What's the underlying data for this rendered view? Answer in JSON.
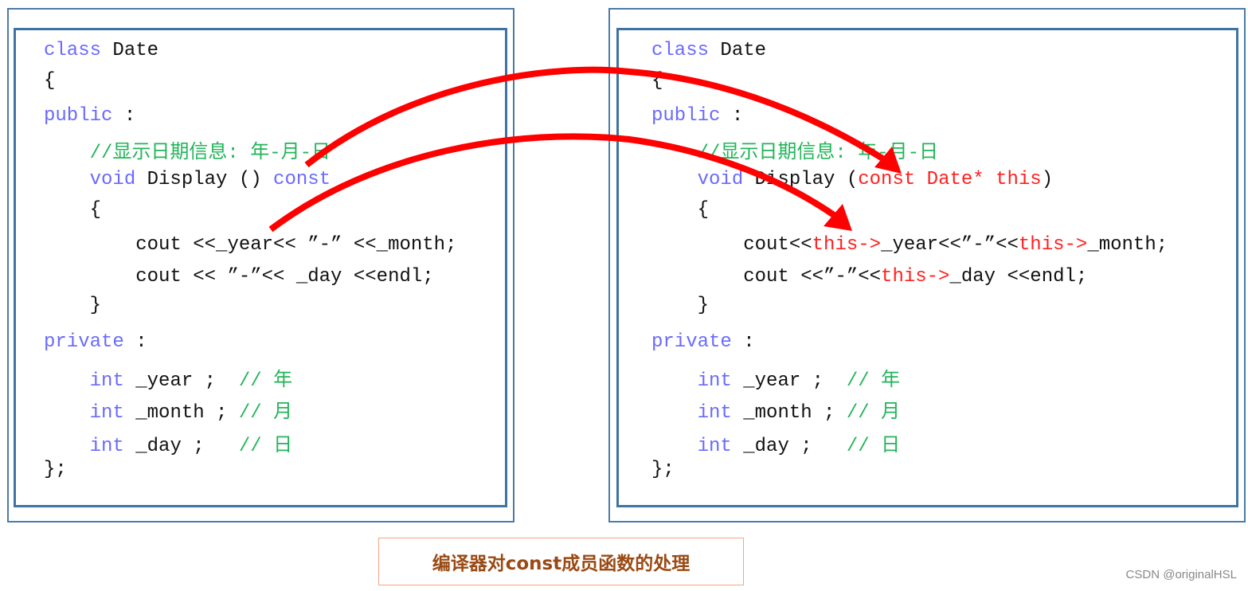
{
  "left_panel": {
    "lines": [
      {
        "parts": [
          {
            "t": "class",
            "c": "kw"
          },
          {
            "t": " Date",
            "c": ""
          }
        ]
      },
      {
        "parts": [
          {
            "t": "{",
            "c": ""
          }
        ]
      },
      {
        "parts": [
          {
            "t": "public",
            "c": "kw"
          },
          {
            "t": " :",
            "c": ""
          }
        ]
      },
      {
        "parts": [
          {
            "t": "    //显示日期信息: 年-月-日",
            "c": "cm"
          }
        ]
      },
      {
        "parts": [
          {
            "t": "    ",
            "c": ""
          },
          {
            "t": "void",
            "c": "kw"
          },
          {
            "t": " Display () ",
            "c": ""
          },
          {
            "t": "const",
            "c": "kw"
          }
        ]
      },
      {
        "parts": [
          {
            "t": "    {",
            "c": ""
          }
        ]
      },
      {
        "parts": [
          {
            "t": "        cout <<_year<< ”-” <<_month;",
            "c": ""
          }
        ]
      },
      {
        "parts": [
          {
            "t": "        cout << ”-”<< _day <<endl;",
            "c": ""
          }
        ]
      },
      {
        "parts": [
          {
            "t": "    }",
            "c": ""
          }
        ]
      },
      {
        "parts": [
          {
            "t": "private",
            "c": "kw"
          },
          {
            "t": " :",
            "c": ""
          }
        ]
      },
      {
        "parts": [
          {
            "t": "    ",
            "c": ""
          },
          {
            "t": "int",
            "c": "kw"
          },
          {
            "t": " _year ;  ",
            "c": ""
          },
          {
            "t": "// 年",
            "c": "cm"
          }
        ]
      },
      {
        "parts": [
          {
            "t": "    ",
            "c": ""
          },
          {
            "t": "int",
            "c": "kw"
          },
          {
            "t": " _month ; ",
            "c": ""
          },
          {
            "t": "// 月",
            "c": "cm"
          }
        ]
      },
      {
        "parts": [
          {
            "t": "    ",
            "c": ""
          },
          {
            "t": "int",
            "c": "kw"
          },
          {
            "t": " _day ;   ",
            "c": ""
          },
          {
            "t": "// 日",
            "c": "cm"
          }
        ]
      },
      {
        "parts": [
          {
            "t": "};",
            "c": ""
          }
        ]
      }
    ]
  },
  "right_panel": {
    "lines": [
      {
        "parts": [
          {
            "t": "class",
            "c": "kw"
          },
          {
            "t": " Date",
            "c": ""
          }
        ]
      },
      {
        "parts": [
          {
            "t": "{",
            "c": ""
          }
        ]
      },
      {
        "parts": [
          {
            "t": "public",
            "c": "kw"
          },
          {
            "t": " :",
            "c": ""
          }
        ]
      },
      {
        "parts": [
          {
            "t": "    //显示日期信息: 年-月-日",
            "c": "cm"
          }
        ]
      },
      {
        "parts": [
          {
            "t": "    ",
            "c": ""
          },
          {
            "t": "void",
            "c": "kw"
          },
          {
            "t": " Display (",
            "c": ""
          },
          {
            "t": "const Date* this",
            "c": "rd"
          },
          {
            "t": ")",
            "c": ""
          }
        ]
      },
      {
        "parts": [
          {
            "t": "    {",
            "c": ""
          }
        ]
      },
      {
        "parts": [
          {
            "t": "        cout<<",
            "c": ""
          },
          {
            "t": "this->",
            "c": "rd"
          },
          {
            "t": "_year<<”-”<<",
            "c": ""
          },
          {
            "t": "this->",
            "c": "rd"
          },
          {
            "t": "_month;",
            "c": ""
          }
        ]
      },
      {
        "parts": [
          {
            "t": "        cout <<”-”<<",
            "c": ""
          },
          {
            "t": "this->",
            "c": "rd"
          },
          {
            "t": "_day <<endl;",
            "c": ""
          }
        ]
      },
      {
        "parts": [
          {
            "t": "    }",
            "c": ""
          }
        ]
      },
      {
        "parts": [
          {
            "t": "private",
            "c": "kw"
          },
          {
            "t": " :",
            "c": ""
          }
        ]
      },
      {
        "parts": [
          {
            "t": "    ",
            "c": ""
          },
          {
            "t": "int",
            "c": "kw"
          },
          {
            "t": " _year ;  ",
            "c": ""
          },
          {
            "t": "// 年",
            "c": "cm"
          }
        ]
      },
      {
        "parts": [
          {
            "t": "    ",
            "c": ""
          },
          {
            "t": "int",
            "c": "kw"
          },
          {
            "t": " _month ; ",
            "c": ""
          },
          {
            "t": "// 月",
            "c": "cm"
          }
        ]
      },
      {
        "parts": [
          {
            "t": "    ",
            "c": ""
          },
          {
            "t": "int",
            "c": "kw"
          },
          {
            "t": " _day ;   ",
            "c": ""
          },
          {
            "t": "// 日",
            "c": "cm"
          }
        ]
      },
      {
        "parts": [
          {
            "t": "};",
            "c": ""
          }
        ]
      }
    ]
  },
  "arrows": [
    {
      "from": "const qualifier (left)",
      "to": "const Date* this (right)",
      "color": "#ff0000"
    },
    {
      "from": "member access (left)",
      "to": "this-> access (right)",
      "color": "#ff0000"
    }
  ],
  "caption": "编译器对const成员函数的处理",
  "watermark": "CSDN @originalHSL",
  "colors": {
    "keyword": "#6a6aff",
    "comment": "#22b55a",
    "highlight": "#ff2020",
    "border": "#3f73a3",
    "caption_text": "#9a4a14",
    "caption_border": "#f2a68a"
  }
}
